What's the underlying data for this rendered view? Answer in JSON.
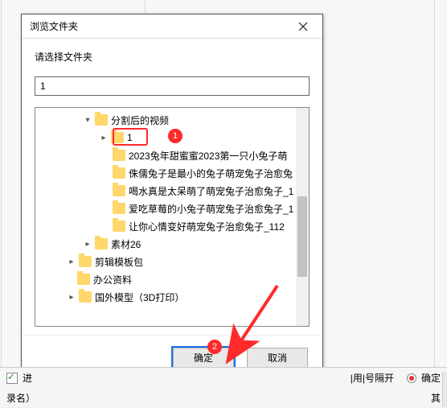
{
  "dialog": {
    "title": "浏览文件夹",
    "prompt": "请选择文件夹",
    "input_value": "1",
    "buttons": {
      "ok": "确定",
      "cancel": "取消"
    }
  },
  "tree": {
    "root": {
      "label": "分割后的视频",
      "expanded": true
    },
    "children": [
      {
        "label": "1",
        "has_children": true,
        "highlighted": true
      },
      {
        "label": "2023兔年甜蜜蜜2023第一只小兔子萌"
      },
      {
        "label": "侏儒兔子是最小的兔子萌宠兔子治愈兔"
      },
      {
        "label": "喝水真是太呆萌了萌宠兔子治愈兔子_1"
      },
      {
        "label": "爱吃草莓的小兔子萌宠兔子治愈兔子_1"
      },
      {
        "label": "让你心情变好萌宠兔子治愈兔子_112"
      }
    ],
    "siblings": [
      {
        "label": "素材26",
        "has_children": true
      },
      {
        "label": "剪辑模板包",
        "has_children": true
      },
      {
        "label": "办公资料"
      },
      {
        "label": "国外模型（3D打印）",
        "has_children": true
      }
    ]
  },
  "annotations": {
    "badge1": "1",
    "badge2": "2"
  },
  "bottom": {
    "left_check": "进",
    "sep_label": "|用|号隔开",
    "radio_confirm": "确定",
    "row2_label": "录名）",
    "row2_rightcut": "其"
  }
}
